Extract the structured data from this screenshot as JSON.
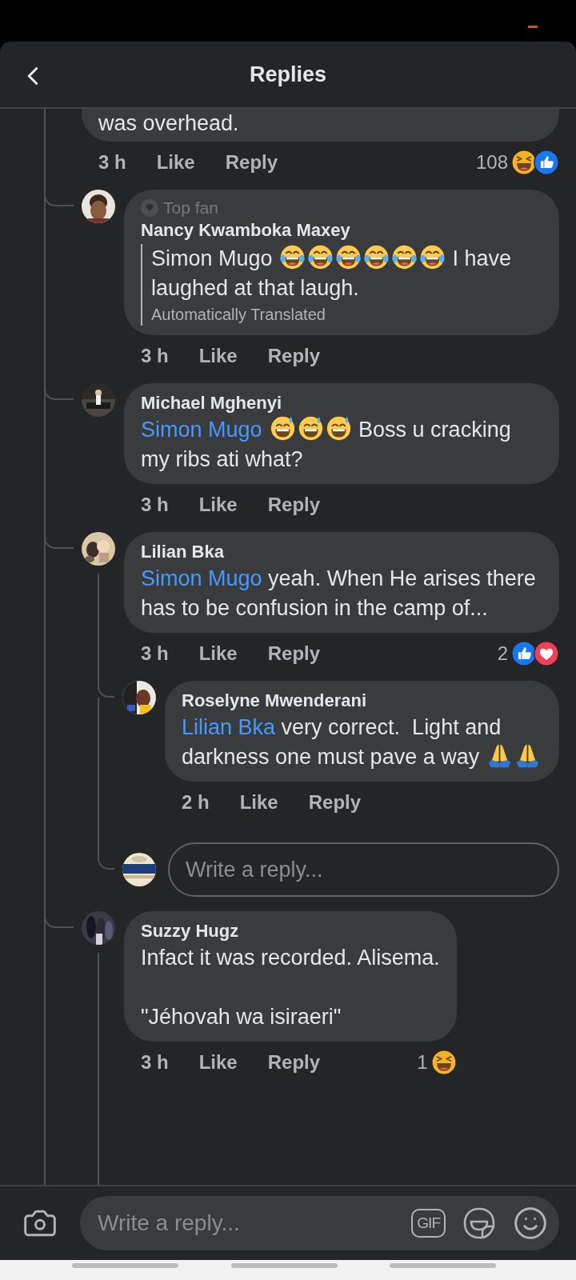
{
  "header": {
    "title": "Replies"
  },
  "thread": {
    "cut_off": true,
    "segments": [
      {
        "kind": "text",
        "text": "was overhead."
      }
    ],
    "time": "3 h",
    "like": "Like",
    "reply": "Reply",
    "reaction_count": "108",
    "reactions": [
      {
        "kind": "haha"
      },
      {
        "kind": "like"
      }
    ],
    "children": [
      {
        "author": "Nancy Kwamboka Maxey",
        "badge": "Top fan",
        "segments": [
          {
            "kind": "text",
            "text": "Simon Mugo "
          },
          {
            "kind": "tears"
          },
          {
            "kind": "tears"
          },
          {
            "kind": "tears"
          },
          {
            "kind": "tears"
          },
          {
            "kind": "tears"
          },
          {
            "kind": "tears"
          },
          {
            "kind": "text",
            "text": " I have laughed at that laugh."
          }
        ],
        "translation_note": "Automatically Translated",
        "time": "3 h",
        "like": "Like",
        "reply": "Reply"
      },
      {
        "author": "Michael Mghenyi",
        "segments": [
          {
            "kind": "mention",
            "text": "Simon Mugo"
          },
          {
            "kind": "sweat"
          },
          {
            "kind": "sweat"
          },
          {
            "kind": "sweat"
          },
          {
            "kind": "text",
            "text": " Boss u cracking my ribs ati what?"
          }
        ],
        "time": "3 h",
        "like": "Like",
        "reply": "Reply"
      },
      {
        "author": "Lilian Bka",
        "segments": [
          {
            "kind": "mention",
            "text": "Simon Mugo"
          },
          {
            "kind": "text",
            "text": " yeah. When He arises there  has to be confusion in the camp of..."
          }
        ],
        "time": "3 h",
        "like": "Like",
        "reply": "Reply",
        "reaction_count": "2",
        "reactions": [
          {
            "kind": "like"
          },
          {
            "kind": "love"
          }
        ],
        "children": [
          {
            "author": "Roselyne Mwenderani",
            "segments": [
              {
                "kind": "mention",
                "text": "Lilian Bka"
              },
              {
                "kind": "text",
                "text": " very correct.  Light and darkness one must pave a way "
              },
              {
                "kind": "pray"
              },
              {
                "kind": "pray"
              }
            ],
            "time": "2 h",
            "like": "Like",
            "reply": "Reply"
          }
        ],
        "reply_field": {
          "placeholder": "Write a reply..."
        }
      },
      {
        "author": "Suzzy Hugz",
        "segments": [
          {
            "kind": "text",
            "text": "Infact it was recorded. Alisema.\n\n\"Jéhovah wa isiraeri\""
          }
        ],
        "time": "3 h",
        "like": "Like",
        "reply": "Reply",
        "reaction_count": "1",
        "reactions": [
          {
            "kind": "haha"
          }
        ],
        "thread_continues": true
      }
    ]
  },
  "composer": {
    "placeholder": "Write a reply...",
    "gif": "GIF"
  }
}
